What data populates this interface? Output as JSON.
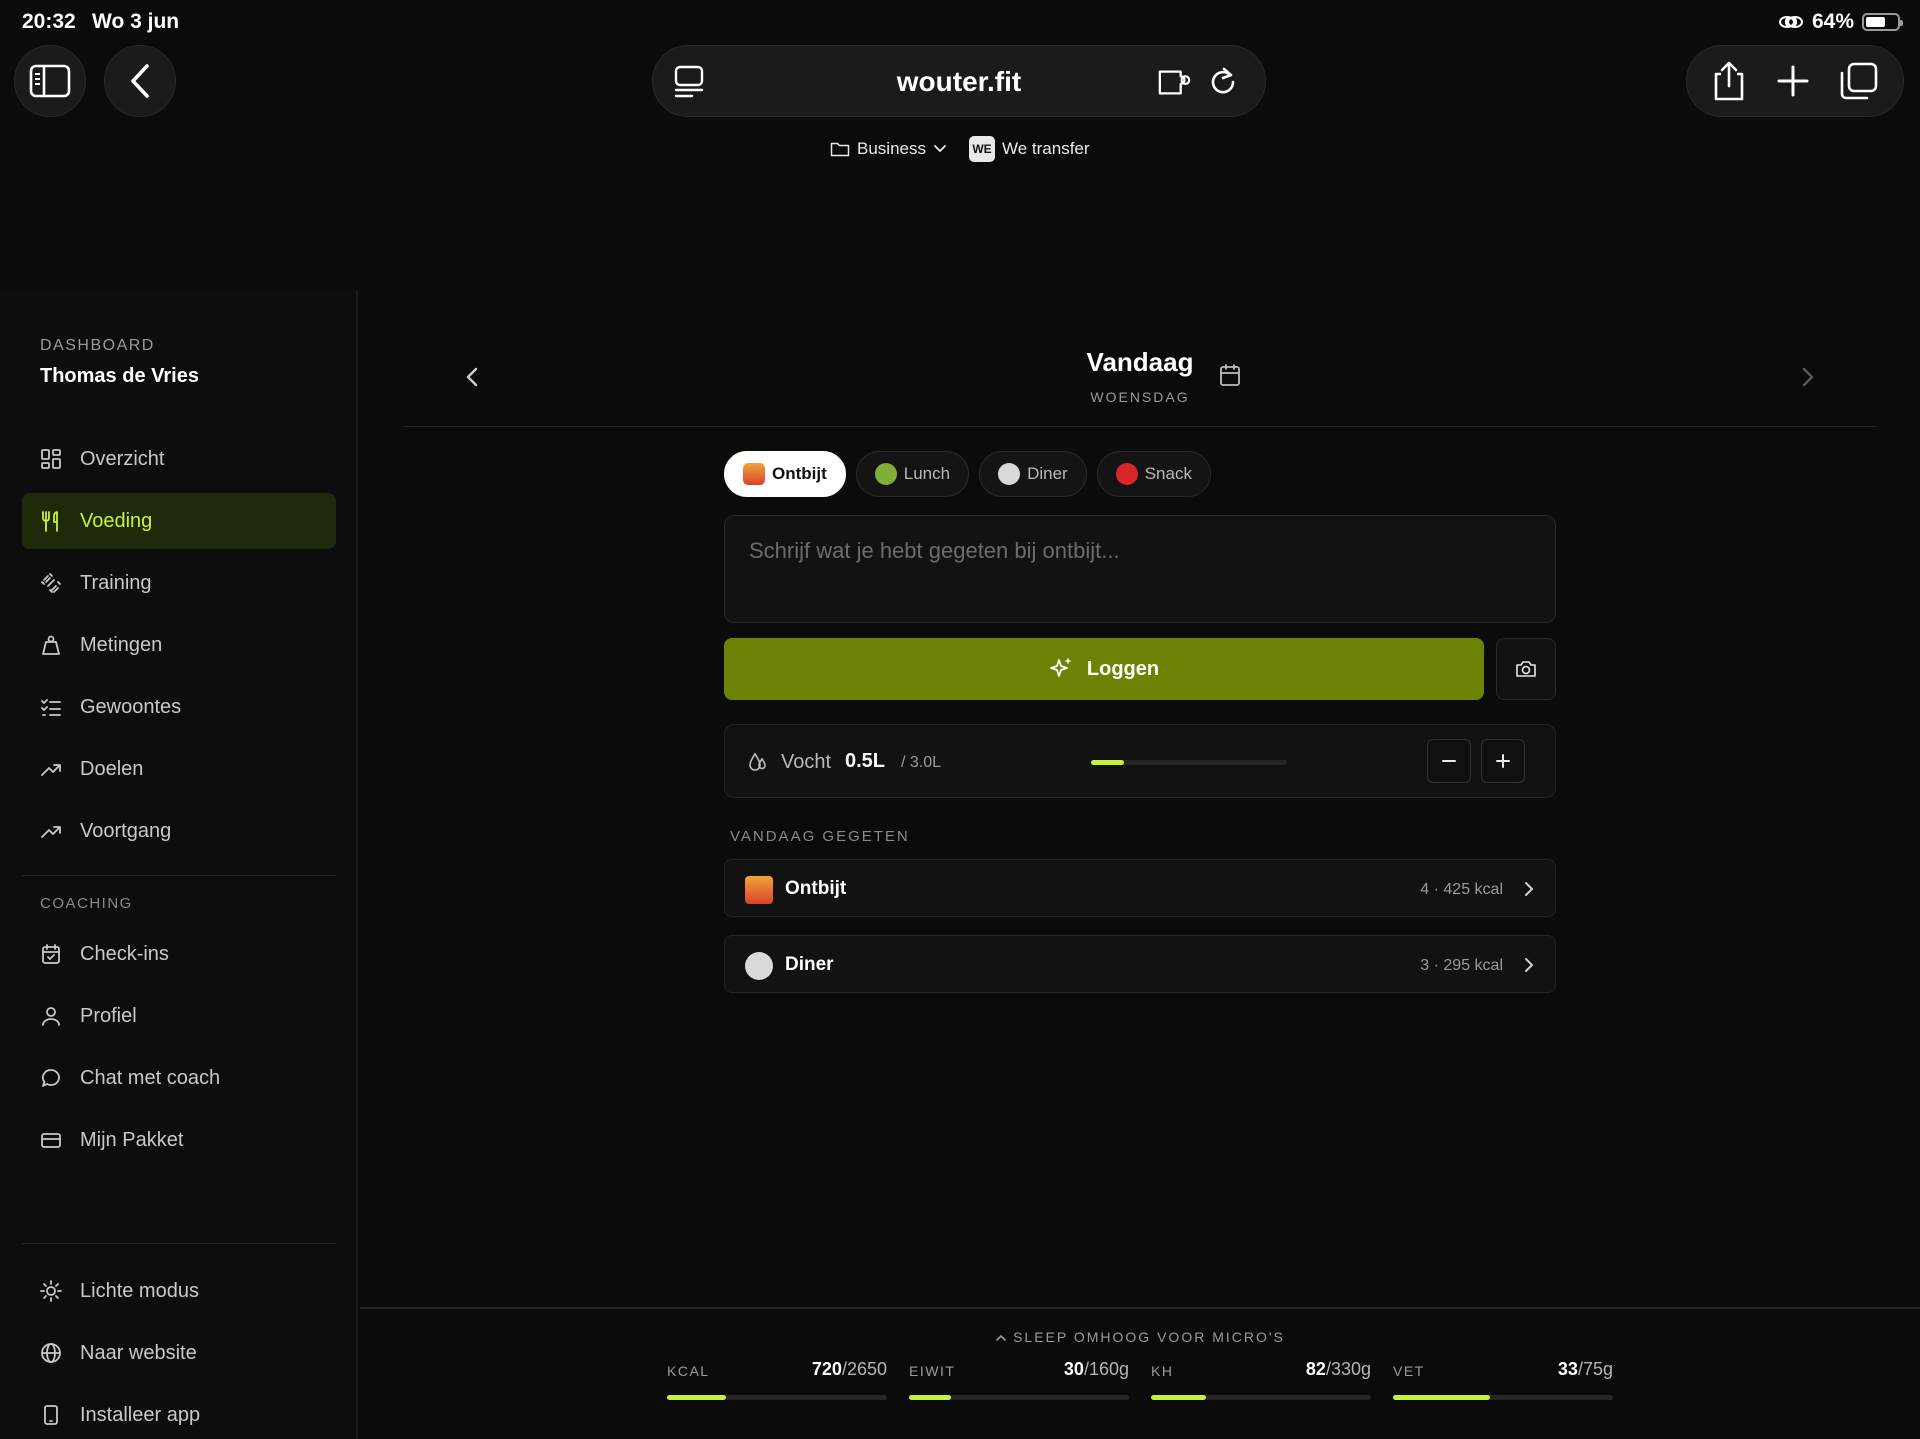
{
  "status": {
    "time": "20:32",
    "date": "Wo 3 jun",
    "battery": "64%",
    "battery_level": 0.64
  },
  "browser": {
    "url": "wouter.fit",
    "bookmarks": [
      {
        "label": "Business",
        "icon": "folder-icon"
      },
      {
        "label": "We transfer",
        "icon": "we-logo"
      }
    ],
    "we_logo_text": "WE"
  },
  "sidebar": {
    "kicker": "DASHBOARD",
    "user": "Thomas de Vries",
    "items": [
      {
        "label": "Overzicht",
        "icon": "grid-icon"
      },
      {
        "label": "Voeding",
        "icon": "cutlery-icon",
        "active": true
      },
      {
        "label": "Training",
        "icon": "dumbbell-icon"
      },
      {
        "label": "Metingen",
        "icon": "scale-icon"
      },
      {
        "label": "Gewoontes",
        "icon": "checklist-icon"
      },
      {
        "label": "Doelen",
        "icon": "trend-icon"
      },
      {
        "label": "Voortgang",
        "icon": "trend-icon"
      }
    ],
    "coaching_title": "COACHING",
    "coaching_items": [
      {
        "label": "Check-ins",
        "icon": "calendar-check-icon"
      },
      {
        "label": "Profiel",
        "icon": "user-icon"
      },
      {
        "label": "Chat met coach",
        "icon": "chat-icon"
      },
      {
        "label": "Mijn Pakket",
        "icon": "card-icon"
      }
    ],
    "footer_items": [
      {
        "label": "Lichte modus",
        "icon": "sun-icon"
      },
      {
        "label": "Naar website",
        "icon": "globe-icon"
      },
      {
        "label": "Installeer app",
        "icon": "phone-icon"
      }
    ]
  },
  "day": {
    "title": "Vandaag",
    "subtitle": "WOENSDAG"
  },
  "meal_tabs": [
    {
      "label": "Ontbijt",
      "active": true,
      "color": "#e87a2d"
    },
    {
      "label": "Lunch",
      "active": false,
      "color": "#7fae3a"
    },
    {
      "label": "Diner",
      "active": false,
      "color": "#d9d9d9"
    },
    {
      "label": "Snack",
      "active": false,
      "color": "#d8262b"
    }
  ],
  "input": {
    "placeholder": "Schrijf wat je hebt gegeten bij ontbijt..."
  },
  "log_button": "Loggen",
  "water": {
    "label": "Vocht",
    "value": "0.5L",
    "goal": "/ 3.0L",
    "fraction": 0.167
  },
  "eaten": {
    "title": "VANDAAG GEGETEN",
    "meals": [
      {
        "name": "Ontbijt",
        "meta": "4 · 425 kcal",
        "color": "#e87a2d"
      },
      {
        "name": "Diner",
        "meta": "3 · 295 kcal",
        "color": "#d9d9d9"
      }
    ]
  },
  "macros": {
    "hint": "SLEEP OMHOOG VOOR MICRO'S",
    "items": [
      {
        "key": "KCAL",
        "value": "720",
        "target": "/2650",
        "fraction": 0.27
      },
      {
        "key": "EIWIT",
        "value": "30",
        "target": "/160g",
        "fraction": 0.19
      },
      {
        "key": "KH",
        "value": "82",
        "target": "/330g",
        "fraction": 0.25
      },
      {
        "key": "VET",
        "value": "33",
        "target": "/75g",
        "fraction": 0.44
      }
    ]
  },
  "colors": {
    "accent": "#c8f23a",
    "log_button": "#6b8406",
    "active_nav_bg": "#1f2a0b"
  }
}
